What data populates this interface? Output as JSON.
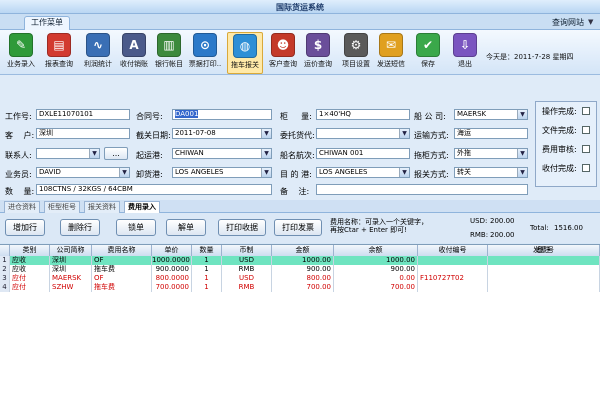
{
  "window": {
    "title": "国际货运系统"
  },
  "menu_tabs": {
    "work_menu": "工作菜单",
    "query_site": "查询网站"
  },
  "toolbar": {
    "items": [
      {
        "label": "业务录入",
        "icon": "form-entry-icon",
        "color": "#2f9a3a",
        "glyph": "✎"
      },
      {
        "label": "报表查询",
        "icon": "report-icon",
        "color": "#d23a2f",
        "glyph": "▤"
      },
      {
        "label": "利润统计",
        "icon": "profit-chart-icon",
        "color": "#3a6fb5",
        "glyph": "∿"
      },
      {
        "label": "收付销账",
        "icon": "ledger-icon",
        "color": "#4a5a8a",
        "glyph": "A"
      },
      {
        "label": "银行帐目",
        "icon": "bank-icon",
        "color": "#3d8a3d",
        "glyph": "▥"
      },
      {
        "label": "票据打印..",
        "icon": "printer-icon",
        "color": "#2b79c9",
        "glyph": "⊙"
      },
      {
        "label": "拖车报关",
        "icon": "globe-truck-icon",
        "color": "#2e8fd6",
        "glyph": "◍"
      },
      {
        "label": "客户查询",
        "icon": "customer-icon",
        "color": "#c43a2a",
        "glyph": "☻"
      },
      {
        "label": "运价查询",
        "icon": "freight-rate-icon",
        "color": "#6a4e9a",
        "glyph": "$"
      },
      {
        "label": "项目设置",
        "icon": "settings-icon",
        "color": "#5a5a5a",
        "glyph": "⚙"
      },
      {
        "label": "发送短信",
        "icon": "sms-icon",
        "color": "#e0a020",
        "glyph": "✉"
      },
      {
        "label": "保存",
        "icon": "save-check-icon",
        "color": "#3aa84a",
        "glyph": "✔"
      },
      {
        "label": "退出",
        "icon": "exit-icon",
        "color": "#7a55c0",
        "glyph": "⇩"
      }
    ],
    "selected_index": 6,
    "today": "今天是：2011-7-28 星期四"
  },
  "form": {
    "work_no_label": "工作号:",
    "work_no": "DXLE11070101",
    "contract_no_label": "合同号:",
    "contract_no": "DA001",
    "container_qty_label": "柜 　 量:",
    "container_qty": "1×40'HQ",
    "shipping_co_label": "船 公 司:",
    "shipping_co": "MAERSK",
    "customer_label": "客 　户:",
    "customer": "深圳",
    "customs_date_label": "截关日期:",
    "customs_date": "2011-07-08",
    "forwarder_label": "委托货代:",
    "forwarder": "",
    "transport_label": "运输方式:",
    "transport": "海运",
    "contact_label": "联系人:",
    "contact": "",
    "more_button": "...",
    "origin_port_label": "起运港:",
    "origin_port": "CHIWAN",
    "vessel_label": "船名航次:",
    "vessel": "CHIWAN 001",
    "pickup_label": "拖柜方式:",
    "pickup": "外拖",
    "salesman_label": "业务员:",
    "salesman": "DAVID",
    "discharge_port_label": "卸货港:",
    "discharge_port": "LOS ANGELES",
    "destination_label": "目 的 港:",
    "destination": "LOS ANGELES",
    "customs_mode_label": "报关方式:",
    "customs_mode": "转关",
    "quantity_label": "数 　量:",
    "quantity": "108CTNS / 32KGS / 64CBM",
    "remark_label": "备 　注:",
    "remark": ""
  },
  "status_panel": {
    "items": [
      {
        "label": "操作完成:",
        "checked": false
      },
      {
        "label": "文件完成:",
        "checked": false
      },
      {
        "label": "费用审核:",
        "checked": false
      },
      {
        "label": "收付完成:",
        "checked": false
      }
    ]
  },
  "sub_tabs": [
    {
      "label": "进仓资料",
      "active": false
    },
    {
      "label": "柜型柜号",
      "active": false
    },
    {
      "label": "报关资料",
      "active": false
    },
    {
      "label": "费用录入",
      "active": true
    }
  ],
  "actions": {
    "add_row": "增加行",
    "delete_row": "删除行",
    "lock": "锁单",
    "unlock": "解单",
    "print_receipt": "打印收据",
    "print_invoice": "打印发票",
    "hint_line1": "费用名称：可录入一个关键字，",
    "hint_line2": "再按Ctar + Enter 即可!",
    "usd_label": "USD:",
    "usd_value": "200.00",
    "rmb_label": "RMB:",
    "rmb_value": "200.00",
    "total_label": "Total:",
    "total_value": "1516.00"
  },
  "grid": {
    "columns": [
      "类别",
      "公司简称",
      "费用名称",
      "单价",
      "数量",
      "币制",
      "金额",
      "余额",
      "收付编号",
      "备注",
      "发票号"
    ],
    "rows": [
      {
        "n": "1",
        "cells": [
          "应收",
          "深圳",
          "OF",
          "1000.0000",
          "1",
          "USD",
          "1000.00",
          "1000.00",
          "",
          "",
          ""
        ],
        "type": "receivable-selected"
      },
      {
        "n": "2",
        "cells": [
          "应收",
          "深圳",
          "拖车费",
          "900.0000",
          "1",
          "RMB",
          "900.00",
          "900.00",
          "",
          "",
          ""
        ],
        "type": "receivable"
      },
      {
        "n": "3",
        "cells": [
          "应付",
          "MAERSK",
          "OF",
          "800.0000",
          "1",
          "USD",
          "800.00",
          "0.00",
          "F110727T02",
          "",
          ""
        ],
        "type": "payable"
      },
      {
        "n": "4",
        "cells": [
          "应付",
          "SZHW",
          "拖车费",
          "700.0000",
          "1",
          "RMB",
          "700.00",
          "700.00",
          "",
          "",
          ""
        ],
        "type": "payable"
      }
    ]
  }
}
